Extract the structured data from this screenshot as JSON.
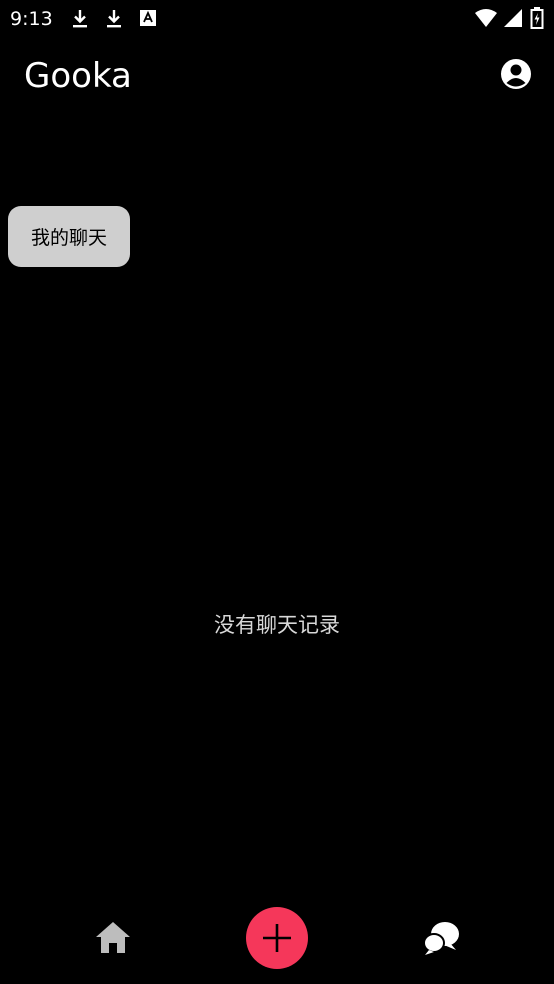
{
  "status_bar": {
    "time": "9:13",
    "left_icons": [
      "download-icon",
      "download-icon",
      "font-a-icon"
    ],
    "right_icons": [
      "wifi-icon",
      "signal-icon",
      "battery-charging-icon"
    ]
  },
  "app_bar": {
    "title": "Gooka",
    "account_icon": "account-circle-icon"
  },
  "filter_chip": {
    "label": "我的聊天"
  },
  "main": {
    "empty_message": "没有聊天记录"
  },
  "bottom_nav": {
    "home_icon": "home-icon",
    "fab_icon": "plus-icon",
    "chats_icon": "chat-bubbles-icon"
  },
  "colors": {
    "background": "#000000",
    "chip_background": "#cfcfcf",
    "fab": "#f5375a",
    "nav_icon": "#bdbdbd",
    "text_primary": "#ffffff",
    "text_muted": "#d8d8d8"
  }
}
